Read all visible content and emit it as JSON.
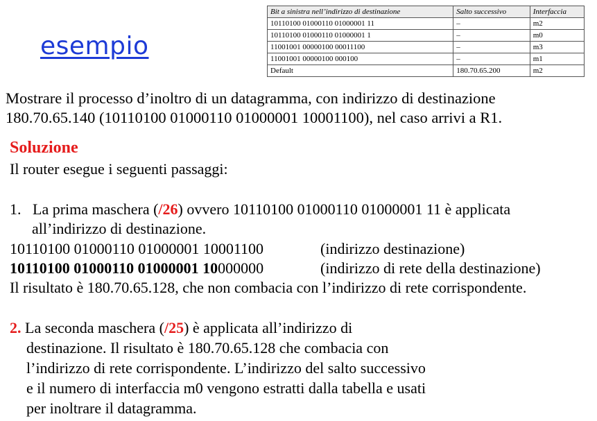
{
  "title": "esempio",
  "table": {
    "headers": [
      "Bit a sinistra nell’indirizzo di destinazione",
      "Salto successivo",
      "Interfaccia"
    ],
    "rows": [
      [
        "10110100 01000110 01000001 11",
        "–",
        "m2"
      ],
      [
        "10110100 01000110 01000001 1",
        "–",
        "m0"
      ],
      [
        "11001001 00000100 00011100",
        "–",
        "m3"
      ],
      [
        "11001001 00000100 000100",
        "–",
        "m1"
      ],
      [
        "Default",
        "180.70.65.200",
        "m2"
      ]
    ]
  },
  "intro": {
    "line1": "Mostrare il processo d’inoltro di un datagramma, con indirizzo di destinazione",
    "line2": "180.70.65.140 (10110100 01000110 01000001 10001100), nel caso arrivi a R1."
  },
  "solution": {
    "heading": "Soluzione",
    "lead": "Il router esegue i seguenti passaggi:",
    "step1": {
      "num": "1.",
      "pre": "La prima maschera (",
      "mask": "/26",
      "post": ") ovvero 10110100 01000110 01000001 11 è applicata",
      "line2": "all’indirizzo di destinazione.",
      "addr1": "10110100 01000110 01000001 10001100",
      "addr1_note": "(indirizzo destinazione)",
      "addr2_bold": "10110100 01000110 01000001 10",
      "addr2_rest": "000000",
      "addr2_note": "(indirizzo di rete della destinazione)",
      "result": "Il risultato è 180.70.65.128, che non combacia con l’indirizzo di rete corrispondente."
    },
    "step2": {
      "num": "2.",
      "pre": " La seconda maschera (",
      "mask": "/25",
      "post": ") è applicata all’indirizzo di",
      "line2": "destinazione. Il risultato è 180.70.65.128 che combacia con",
      "line3": "l’indirizzo di rete corrispondente. L’indirizzo del salto successivo",
      "line4": "e il numero di interfaccia m0 vengono estratti dalla tabella e usati",
      "line5": "per inoltrare  il datagramma."
    }
  }
}
